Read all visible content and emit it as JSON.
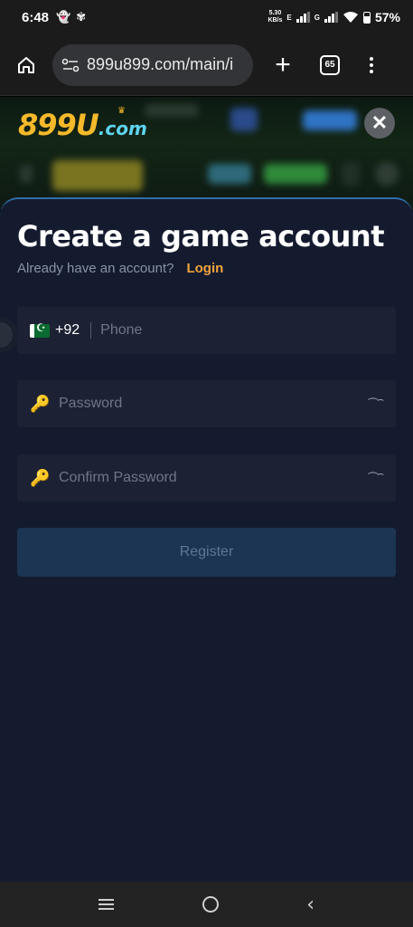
{
  "status_bar": {
    "time": "6:48",
    "net_speed": "5.30\nKB/s",
    "net_type_1": "E",
    "net_type_2": "G",
    "battery_pct": "57%"
  },
  "browser": {
    "url": "899u899.com/main/i",
    "tab_count": "65"
  },
  "site": {
    "logo_main": "899U",
    "logo_suffix": ".com"
  },
  "form": {
    "title": "Create a game account",
    "subtitle": "Already have an account?",
    "login_link": "Login",
    "country_code": "+92",
    "phone_placeholder": "Phone",
    "password_placeholder": "Password",
    "confirm_placeholder": "Confirm Password",
    "register_label": "Register"
  },
  "colors": {
    "accent": "#f3a43b",
    "sheet_bg": "#141b2f",
    "field_bg": "#1c2234",
    "button_bg": "#1b3552"
  }
}
